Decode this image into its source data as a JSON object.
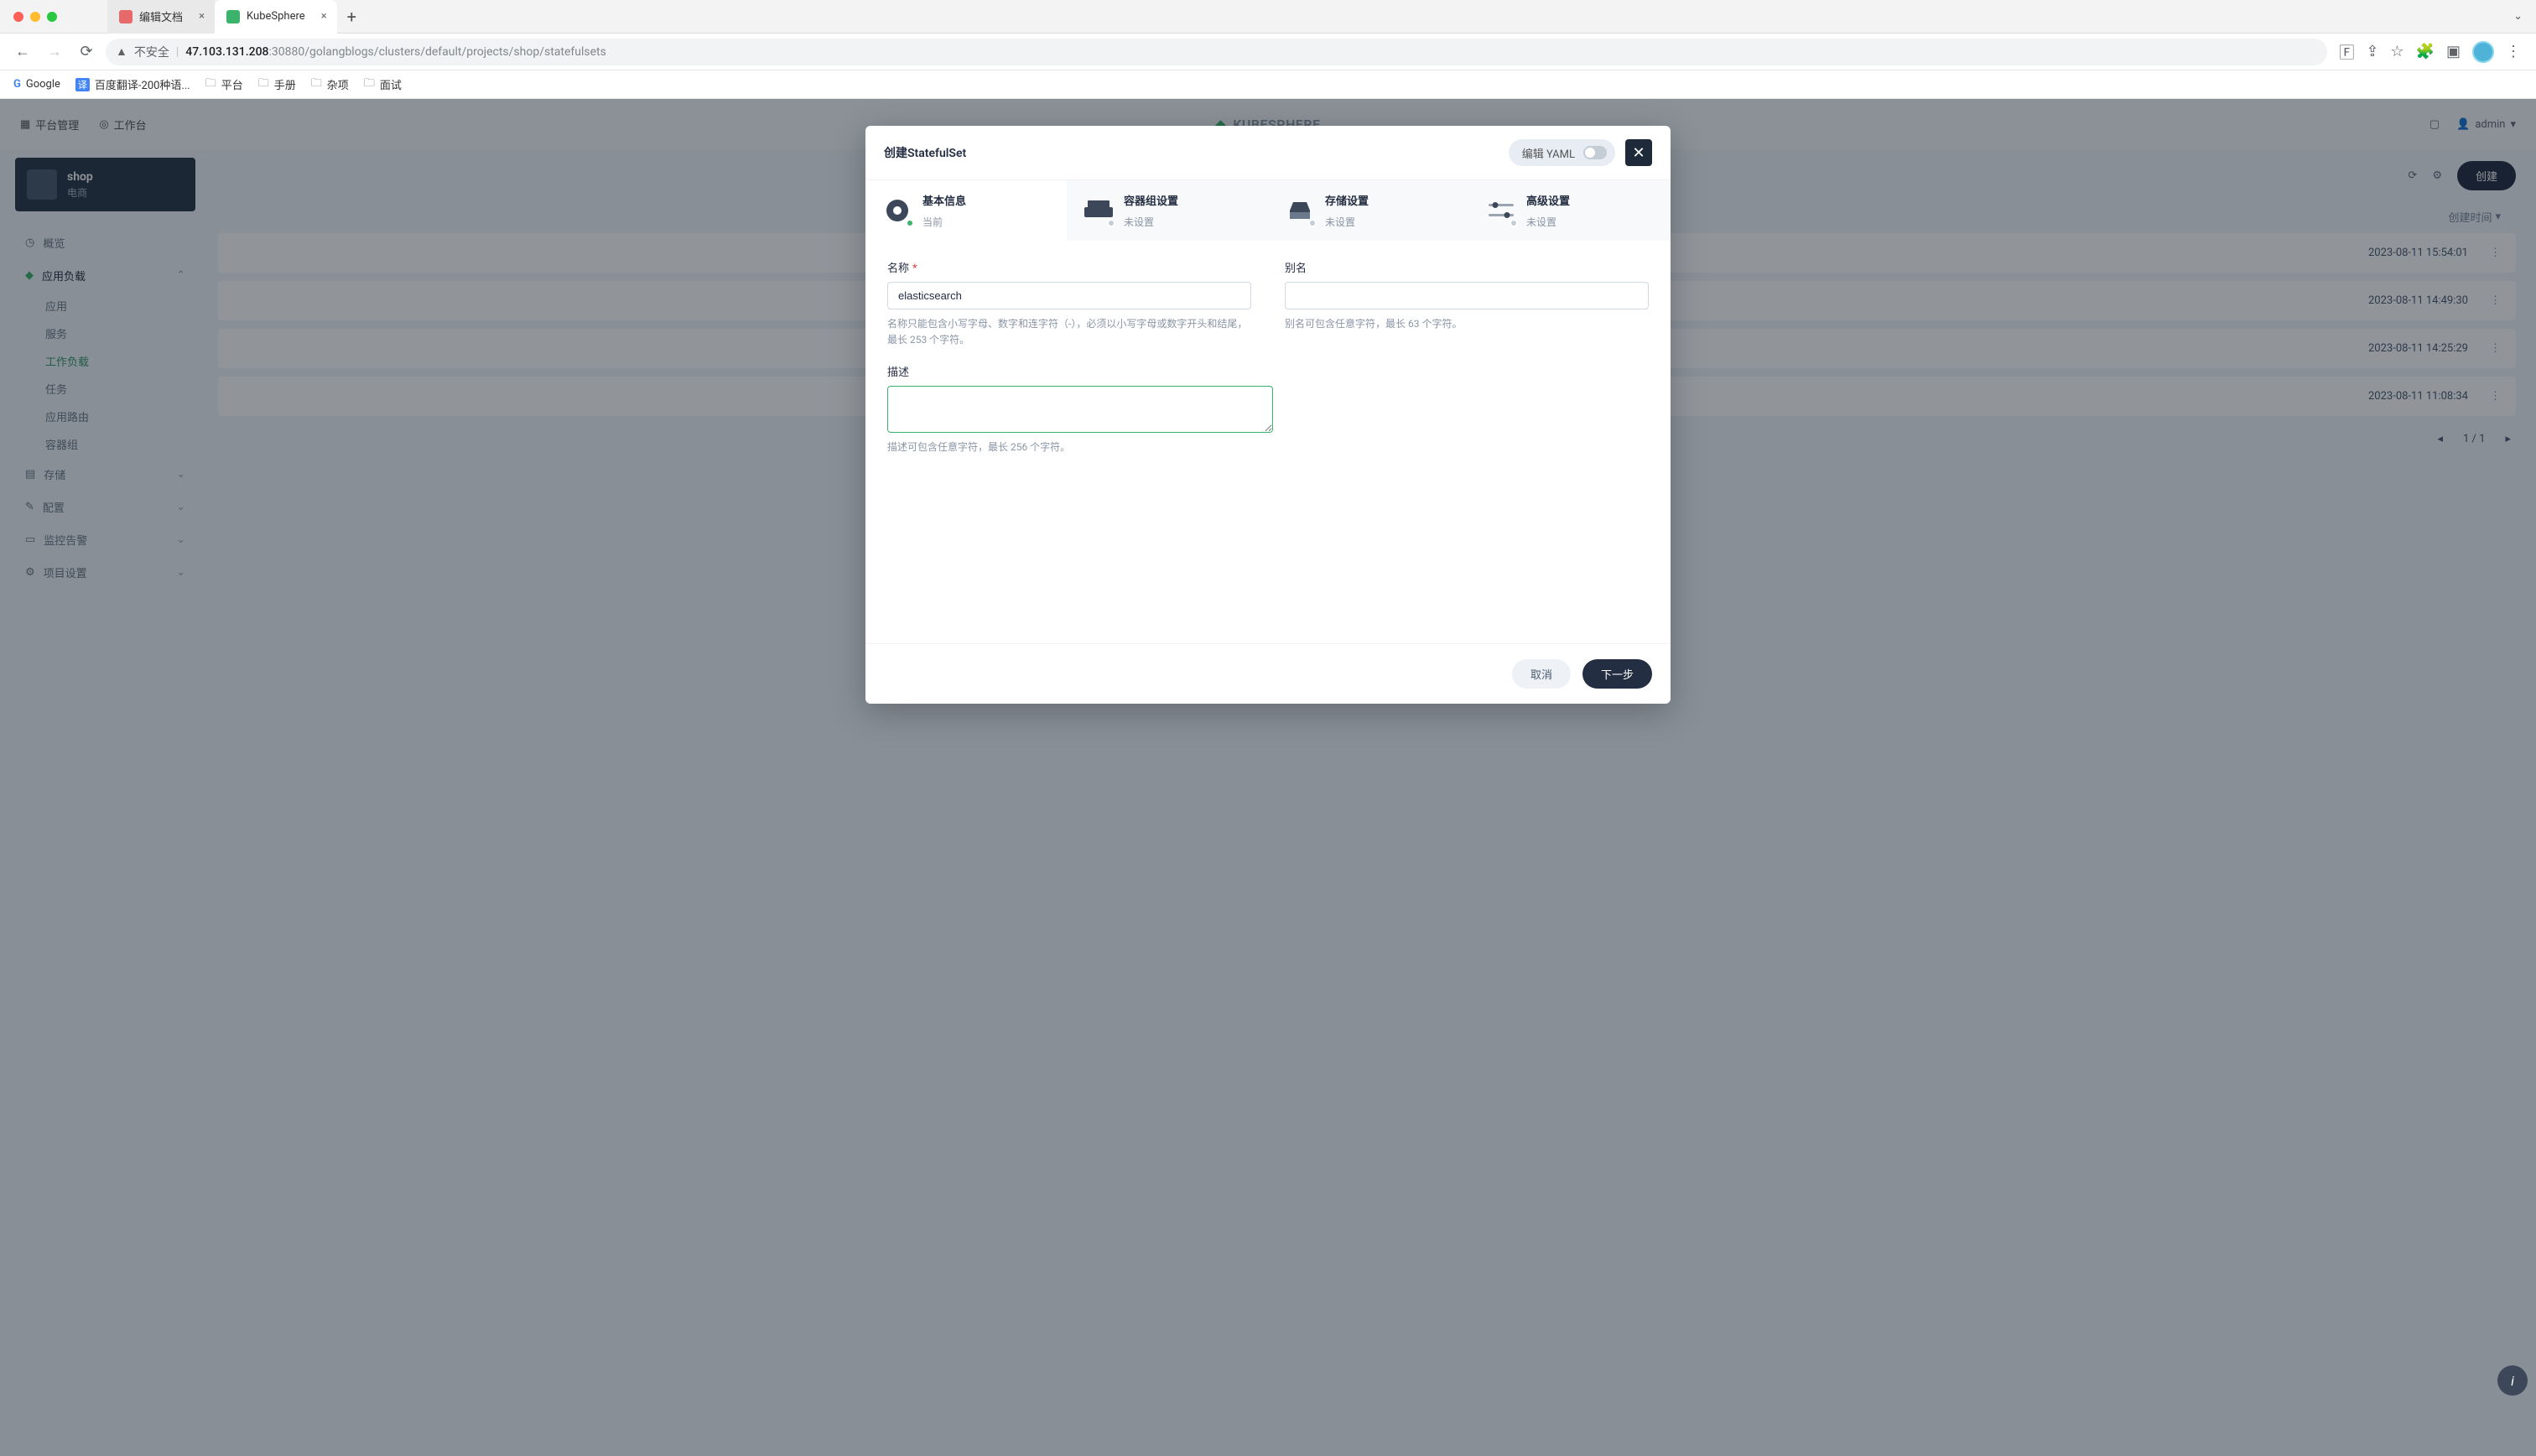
{
  "browser": {
    "tabs": [
      {
        "label": "编辑文档",
        "active": false
      },
      {
        "label": "KubeSphere",
        "active": true
      }
    ],
    "security_label": "不安全",
    "url_host": "47.103.131.208",
    "url_path": ":30880/golangblogs/clusters/default/projects/shop/statefulsets",
    "bookmarks": [
      {
        "label": "Google",
        "kind": "site"
      },
      {
        "label": "百度翻译-200种语...",
        "kind": "site"
      },
      {
        "label": "平台",
        "kind": "folder"
      },
      {
        "label": "手册",
        "kind": "folder"
      },
      {
        "label": "杂项",
        "kind": "folder"
      },
      {
        "label": "面试",
        "kind": "folder"
      }
    ]
  },
  "header": {
    "platform": "平台管理",
    "workspace": "工作台",
    "brand": "KUBESPHERE",
    "user": "admin"
  },
  "sidebar": {
    "project": {
      "name": "shop",
      "desc": "电商"
    },
    "overview": "概览",
    "workloads": {
      "label": "应用负载",
      "items": [
        "应用",
        "服务",
        "工作负载",
        "任务",
        "应用路由",
        "容器组"
      ],
      "active_index": 2
    },
    "others": [
      "存储",
      "配置",
      "监控告警",
      "项目设置"
    ]
  },
  "list": {
    "create_label": "创建",
    "col_time": "创建时间",
    "rows": [
      {
        "time": "2023-08-11 15:54:01"
      },
      {
        "time": "2023-08-11 14:49:30"
      },
      {
        "time": "2023-08-11 14:25:29"
      },
      {
        "time": "2023-08-11 11:08:34"
      }
    ],
    "pager": "1 / 1"
  },
  "modal": {
    "title": "创建StatefulSet",
    "yaml_label": "编辑 YAML",
    "steps": [
      {
        "label": "基本信息",
        "sub": "当前"
      },
      {
        "label": "容器组设置",
        "sub": "未设置"
      },
      {
        "label": "存储设置",
        "sub": "未设置"
      },
      {
        "label": "高级设置",
        "sub": "未设置"
      }
    ],
    "form": {
      "name_label": "名称",
      "name_value": "elasticsearch",
      "name_hint": "名称只能包含小写字母、数字和连字符（-），必须以小写字母或数字开头和结尾，最长 253 个字符。",
      "alias_label": "别名",
      "alias_value": "",
      "alias_hint": "别名可包含任意字符，最长 63 个字符。",
      "desc_label": "描述",
      "desc_value": "",
      "desc_hint": "描述可包含任意字符，最长 256 个字符。"
    },
    "buttons": {
      "cancel": "取消",
      "next": "下一步"
    }
  }
}
